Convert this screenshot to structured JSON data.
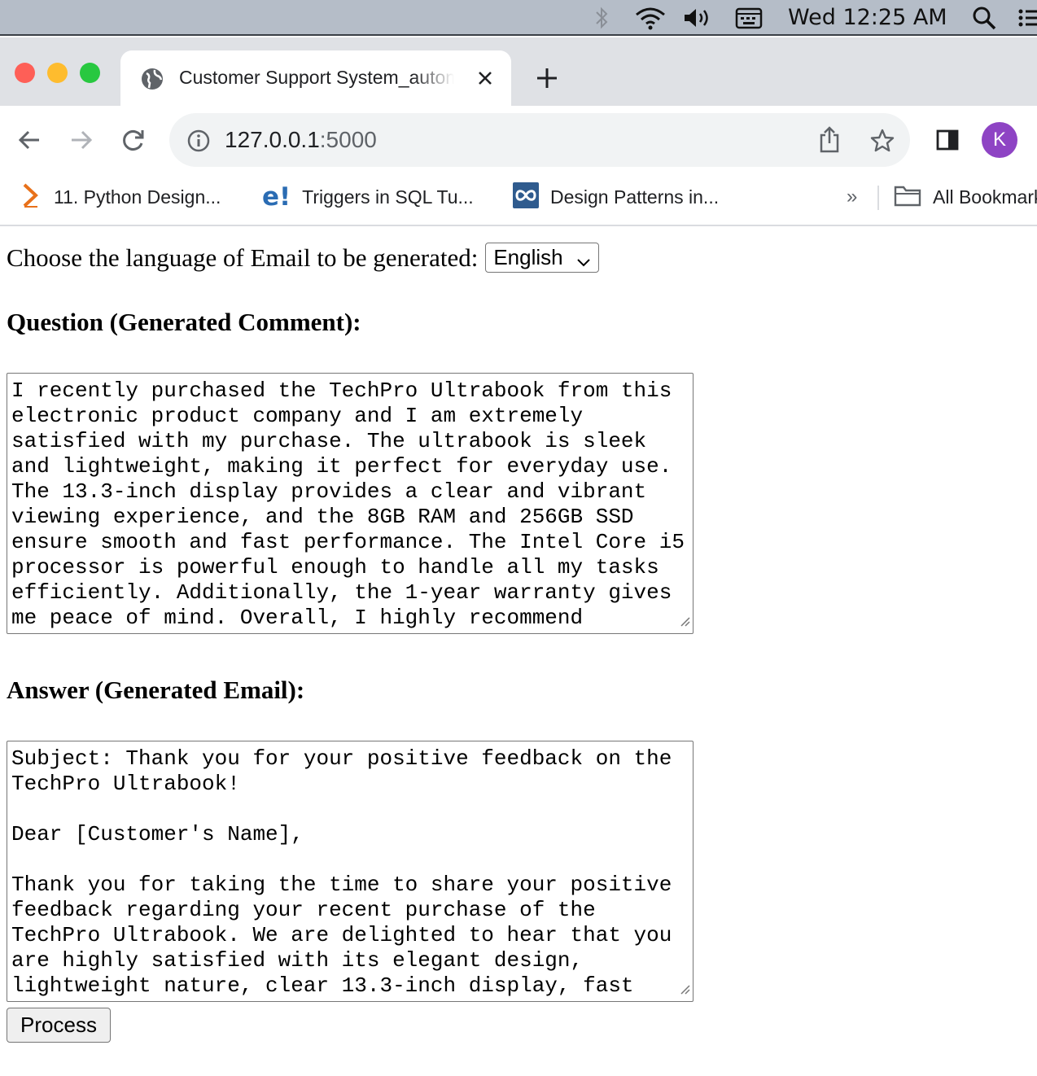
{
  "menubar": {
    "clock": "Wed 12:25 AM",
    "icons": [
      "bluetooth-icon",
      "wifi-icon",
      "volume-icon",
      "keyboard-icon",
      "spotlight-search-icon",
      "control-center-icon"
    ]
  },
  "browser": {
    "tab_title": "Customer Support System_automation",
    "url_host": "127.0.0.1",
    "url_port": ":5000",
    "profile_initial": "K",
    "bookmarks": [
      {
        "label": "11. Python Design...",
        "icon": "bookmark-favicon-chevron"
      },
      {
        "label": "Triggers in SQL Tu...",
        "icon": "bookmark-favicon-e"
      },
      {
        "label": "Design Patterns in...",
        "icon": "bookmark-favicon-infinity"
      }
    ],
    "overflow_label": "»",
    "all_bookmarks_label": "All Bookmarks"
  },
  "colors": {
    "menubar_bg": "#b5bdc8",
    "tabstrip_bg": "#dfe1e5",
    "avatar_bg": "#8e44c4",
    "traffic_red": "#fe5f57",
    "traffic_yellow": "#febc2e",
    "traffic_green": "#28c840"
  },
  "page": {
    "language_label": "Choose the language of Email to be generated:",
    "language_selected": "English",
    "question_heading": "Question (Generated Comment):",
    "question_text": "I recently purchased the TechPro Ultrabook from this electronic product company and I am extremely satisfied with my purchase. The ultrabook is sleek and lightweight, making it perfect for everyday use. The 13.3-inch display provides a clear and vibrant viewing experience, and the 8GB RAM and 256GB SSD ensure smooth and fast performance. The Intel Core i5 processor is powerful enough to handle all my tasks efficiently. Additionally, the 1-year warranty gives me peace of mind. Overall, I highly recommend",
    "answer_heading": "Answer (Generated Email):",
    "answer_text": "Subject: Thank you for your positive feedback on the TechPro Ultrabook!\n\nDear [Customer's Name],\n\nThank you for taking the time to share your positive feedback regarding your recent purchase of the TechPro Ultrabook. We are delighted to hear that you are highly satisfied with its elegant design, lightweight nature, clear 13.3-inch display, fast",
    "process_button": "Process"
  }
}
